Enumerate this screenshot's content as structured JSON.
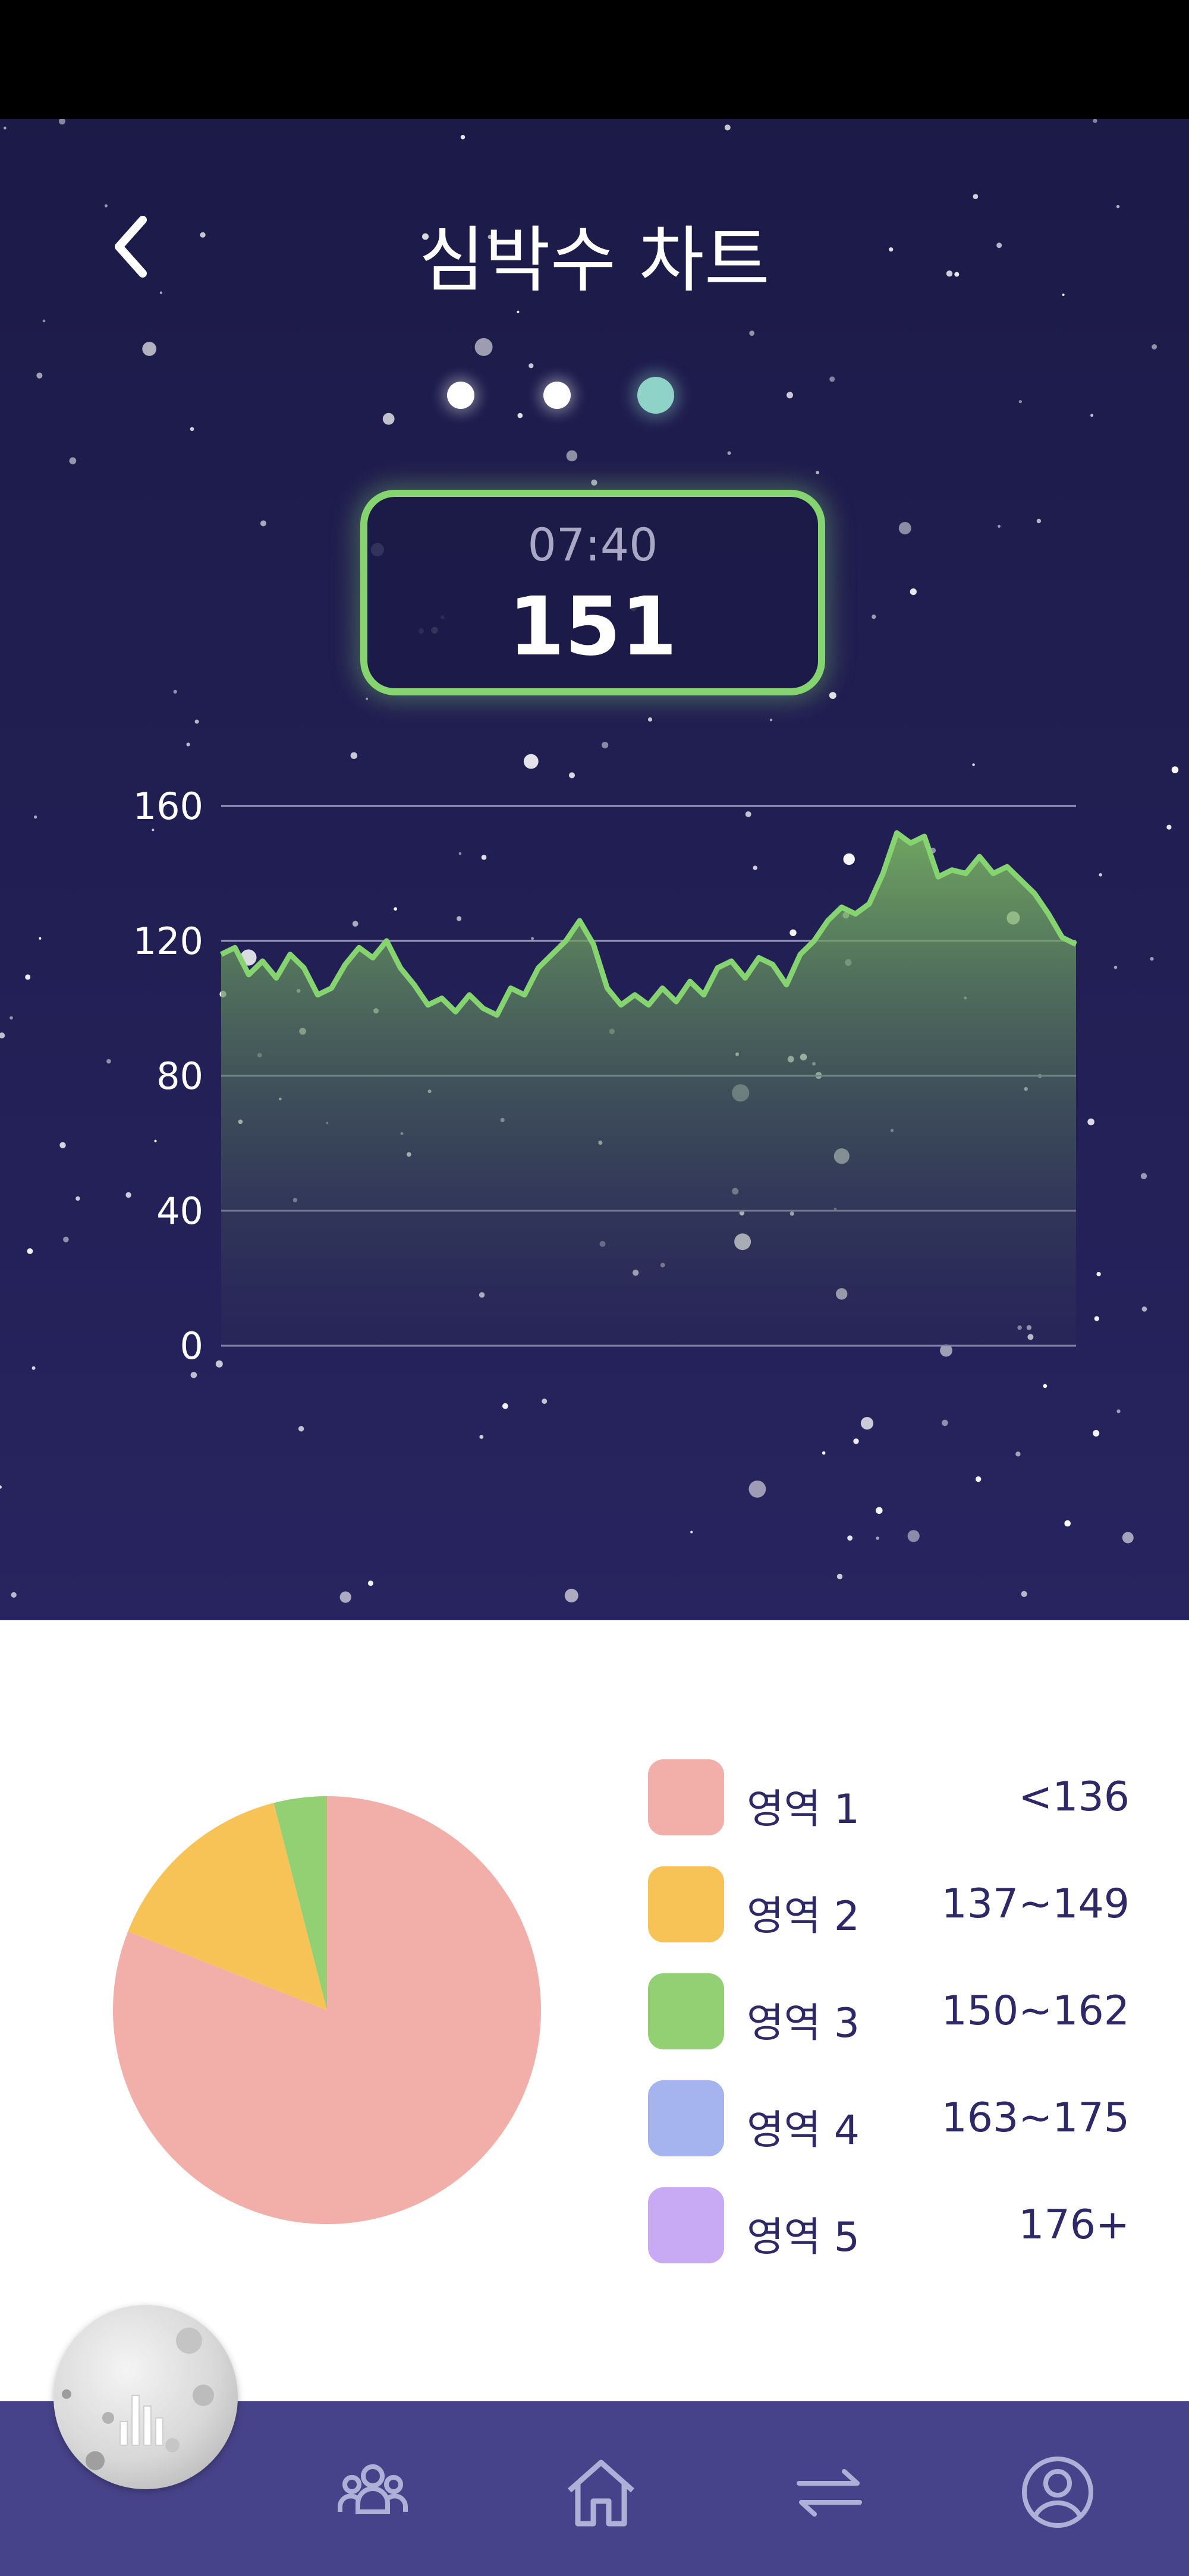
{
  "header": {
    "title": "심박수 차트",
    "back_icon": "chevron-left-icon"
  },
  "pager": {
    "pages": 3,
    "active_index": 2
  },
  "tooltip": {
    "time": "07:40",
    "value": "151"
  },
  "chart_data": {
    "type": "area",
    "ylim": [
      0,
      160
    ],
    "y_ticks": [
      "160",
      "120",
      "80",
      "40",
      "0"
    ],
    "series_color": "#86d46f",
    "grid": true,
    "values": [
      116,
      118,
      110,
      114,
      109,
      116,
      112,
      104,
      106,
      113,
      118,
      115,
      120,
      112,
      107,
      101,
      103,
      99,
      104,
      100,
      98,
      106,
      104,
      112,
      116,
      120,
      126,
      119,
      106,
      101,
      104,
      101,
      106,
      102,
      108,
      104,
      112,
      114,
      109,
      115,
      113,
      107,
      116,
      120,
      126,
      130,
      128,
      131,
      140,
      152,
      149,
      151,
      139,
      141,
      140,
      145,
      140,
      142,
      138,
      134,
      128,
      121,
      119
    ]
  },
  "zones": {
    "pie_data": {
      "type": "pie",
      "slices": [
        {
          "label": "영역 1",
          "value": 81
        },
        {
          "label": "영역 2",
          "value": 15
        },
        {
          "label": "영역 3",
          "value": 4
        },
        {
          "label": "영역 4",
          "value": 0
        },
        {
          "label": "영역 5",
          "value": 0
        }
      ]
    },
    "items": [
      {
        "name": "영역 1",
        "range": "<136",
        "color": "#f2aea9"
      },
      {
        "name": "영역 2",
        "range": "137~149",
        "color": "#f7c357"
      },
      {
        "name": "영역 3",
        "range": "150~162",
        "color": "#93cf73"
      },
      {
        "name": "영역 4",
        "range": "163~175",
        "color": "#a5b3ef"
      },
      {
        "name": "영역 5",
        "range": "176+",
        "color": "#c7a9f4"
      }
    ]
  },
  "navbar": {
    "items": [
      {
        "icon": "community-icon"
      },
      {
        "icon": "home-icon"
      },
      {
        "icon": "swap-icon"
      },
      {
        "icon": "profile-icon"
      }
    ]
  },
  "floating_button": {
    "icon": "moon-stats-icon"
  }
}
